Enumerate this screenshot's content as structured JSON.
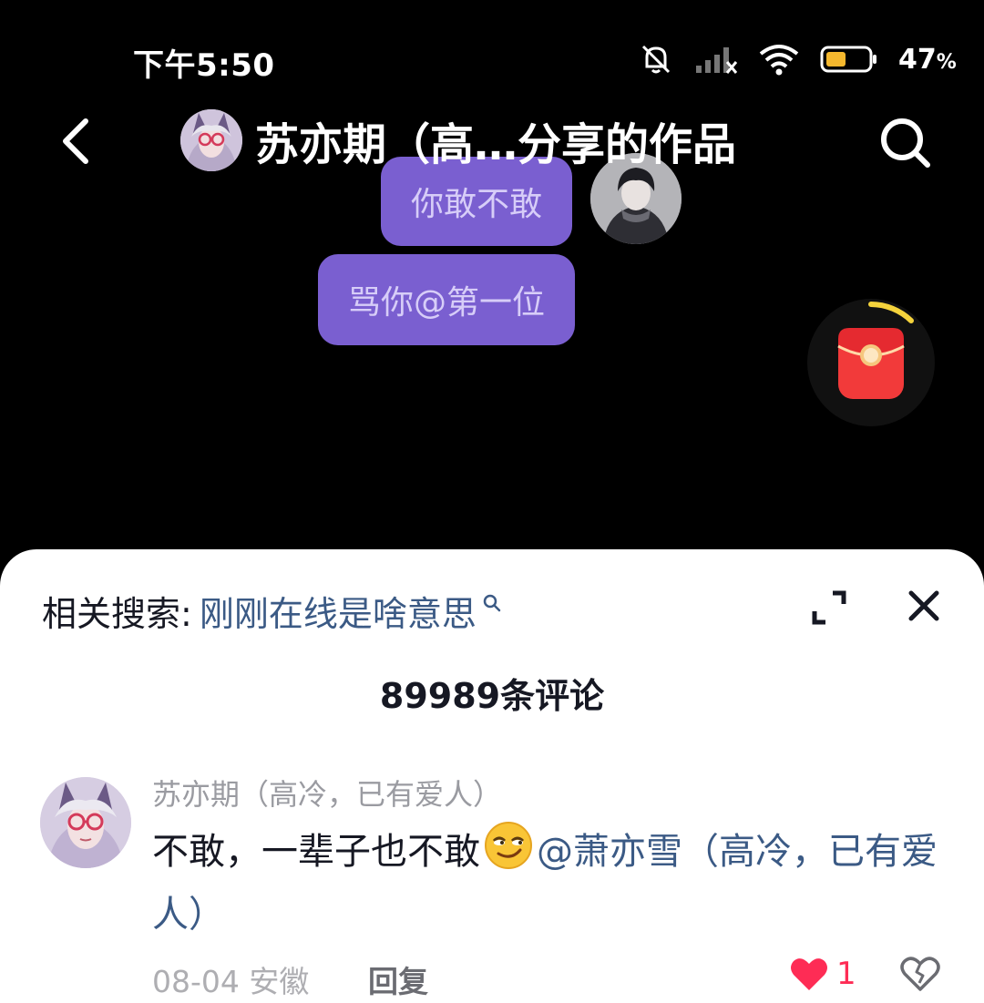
{
  "status_bar": {
    "time": "下午5:50",
    "battery_percent": "47",
    "battery_symbol": "%",
    "battery_level": 0.47,
    "icons": [
      "bell-muted-icon",
      "signal-icon",
      "wifi-icon",
      "battery-icon"
    ]
  },
  "nav": {
    "title": "苏亦期（高…分享的作品",
    "back_icon": "chevron-left-icon",
    "search_icon": "search-icon"
  },
  "video": {
    "bubble_1": "你敢不敢",
    "bubble_2": "骂你@第一位"
  },
  "comments_panel": {
    "related_label": "相关搜索:",
    "related_query": "刚刚在线是啥意思",
    "count_text": "89989条评论",
    "comments": [
      {
        "author": "苏亦期（高冷，已有爱人）",
        "text": "不敢，一辈子也不敢",
        "emoji": "smirk-emoji",
        "mention": "@萧亦雪（高冷，已有爱人）",
        "date": "08-04",
        "location": "安徽",
        "reply_label": "回复",
        "likes": "1"
      }
    ]
  },
  "colors": {
    "bubble": "#7a5fd0",
    "link": "#3b5a85",
    "like": "#fe2c55",
    "redpacket": "#f23a3a"
  }
}
